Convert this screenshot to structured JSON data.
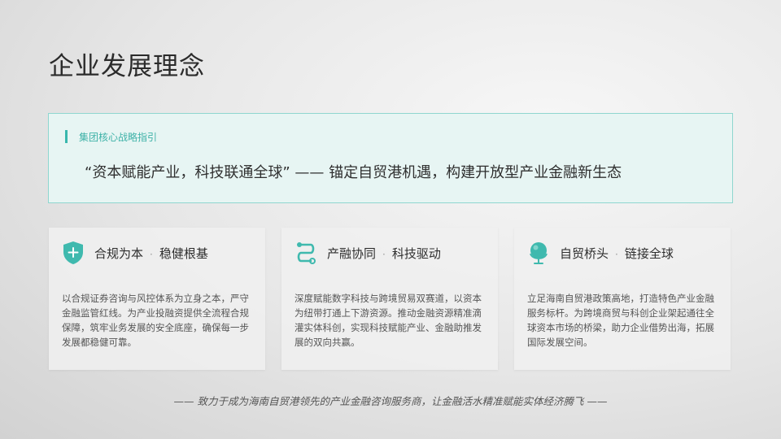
{
  "header": {
    "title": "企业发展理念"
  },
  "banner": {
    "tag": "集团核心战略指引",
    "quote": "“资本赋能产业，科技联通全球” —— 锚定自贸港机遇，构建开放型产业金融新生态"
  },
  "cards": [
    {
      "icon": "shield-plus-icon",
      "title_a": "合规为本",
      "separator": "·",
      "title_b": "稳健根基",
      "body": "以合规证券咨询与风控体系为立身之本，严守金融监管红线。为产业投融资提供全流程合规保障，筑牢业务发展的安全底座，确保每一步发展都稳健可靠。"
    },
    {
      "icon": "route-icon",
      "title_a": "产融协同",
      "separator": "·",
      "title_b": "科技驱动",
      "body": "深度赋能数字科技与跨境贸易双赛道，以资本为纽带打通上下游资源。推动金融资源精准滴灌实体科创，实现科技赋能产业、金融助推发展的双向共赢。"
    },
    {
      "icon": "globe-icon",
      "title_a": "自贸桥头",
      "separator": "·",
      "title_b": "链接全球",
      "body": "立足海南自贸港政策高地，打造特色产业金融服务标杆。为跨境商贸与科创企业架起通往全球资本市场的桥梁，助力企业借势出海，拓展国际发展空间。"
    }
  ],
  "footer": {
    "text": "—— 致力于成为海南自贸港领先的产业金融咨询服务商，让金融活水精准赋能实体经济腾飞 ——"
  },
  "colors": {
    "accent": "#38b7ad",
    "banner_bg": "#e7f5f3",
    "banner_border": "#8fd6cf"
  }
}
